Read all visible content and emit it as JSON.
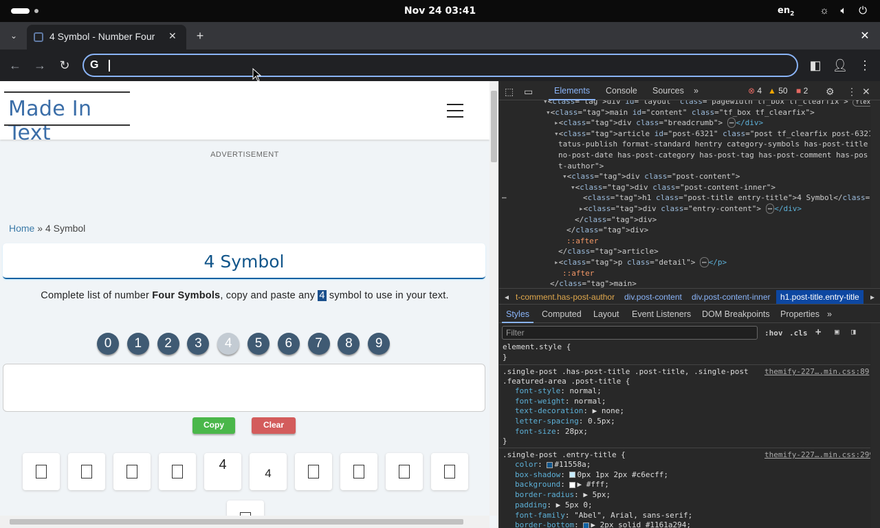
{
  "system": {
    "clock": "Nov 24  03:41",
    "lang": "en",
    "lang_sub": "2"
  },
  "browser": {
    "tab_title": "4 Symbol - Number Four",
    "address_text": ""
  },
  "page": {
    "logo": "Made In Text",
    "ad_label": "ADVERTISEMENT",
    "breadcrumb_home": "Home",
    "breadcrumb_sep": " » ",
    "breadcrumb_current": "4 Symbol",
    "title": "4 Symbol",
    "desc_pre": "Complete list of number ",
    "desc_bold": "Four Symbols",
    "desc_mid": ", copy and paste any ",
    "desc_hl": "4",
    "desc_post": " symbol to use in your text.",
    "numbers": [
      "0",
      "1",
      "2",
      "3",
      "4",
      "5",
      "6",
      "7",
      "8",
      "9"
    ],
    "selected_number": "4",
    "copy_label": "Copy",
    "clear_label": "Clear",
    "symbols": [
      "□",
      "□",
      "□",
      "□",
      "4",
      "4",
      "□",
      "□",
      "□",
      "□",
      "□"
    ]
  },
  "devtools": {
    "tabs": [
      "Elements",
      "Console",
      "Sources"
    ],
    "errors": "4",
    "warnings": "50",
    "issues": "2",
    "tree": [
      "<div id=\"layout\" class=\"pagewidth tf_box tf_clearfix\">",
      "<main id=\"content\" class=\"tf_box tf_clearfix\">",
      "<div class=\"breadcrumb\">",
      "<article id=\"post-6321\" class=\"post tf_clearfix post-6321 type-post s",
      "tatus-publish format-standard hentry category-symbols has-post-title",
      "no-post-date has-post-category has-post-tag has-post-comment has-pos",
      "t-author\">",
      "<div class=\"post-content\">",
      "<div class=\"post-content-inner\">",
      "<h1 class=\"post-title entry-title\">4 Symbol</h1>",
      "<div class=\"entry-content\">",
      "</div>",
      "</div>",
      "::after",
      "</article>",
      "<p class=\"detail\">",
      "::after",
      "</main>"
    ],
    "flex_badge": "flex",
    "eq_badge": "== $0",
    "crumbs": [
      "t-comment.has-post-author",
      "div.post-content",
      "div.post-content-inner",
      "h1.post-title.entry-title"
    ],
    "subtabs": [
      "Styles",
      "Computed",
      "Layout",
      "Event Listeners",
      "DOM Breakpoints",
      "Properties"
    ],
    "filter_placeholder": "Filter",
    "hov": ":hov",
    "cls": ".cls",
    "styles": {
      "element_style": "element.style {",
      "close": "}",
      "rule1_selector_a": ".single-post .has-post-title .post-title, .single-post",
      "rule1_selector_b": ".featured-area .post-title {",
      "rule1_source": "themify-227….min.css:89",
      "rule1_props": [
        [
          "font-style",
          "normal;"
        ],
        [
          "font-weight",
          "normal;"
        ],
        [
          "text-decoration",
          "▶ none;"
        ],
        [
          "letter-spacing",
          "0.5px;"
        ],
        [
          "font-size",
          "28px;"
        ]
      ],
      "rule2_selector": ".single-post .entry-title {",
      "rule2_source": "themify-227….min.css:299",
      "rule2_props": [
        [
          "color",
          "#11558a;"
        ],
        [
          "box-shadow",
          "0px 1px 2px #c6ecff;"
        ],
        [
          "background",
          "▶ #fff;"
        ],
        [
          "border-radius",
          "▶ 5px;"
        ],
        [
          "padding",
          "▶ 5px 0;"
        ],
        [
          "font-family",
          "\"Abel\", Arial, sans-serif;"
        ],
        [
          "border-bottom",
          "▶ 2px solid #1161a294;"
        ]
      ]
    }
  }
}
